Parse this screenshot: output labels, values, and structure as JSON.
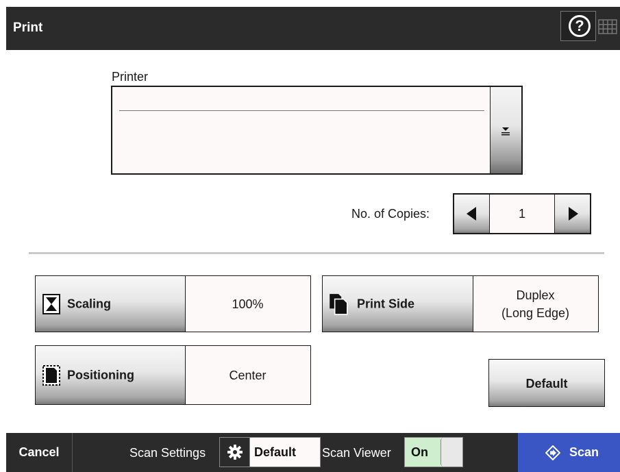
{
  "header": {
    "title": "Print",
    "help_icon": "help-circle-icon",
    "keyboard_icon": "keyboard-icon"
  },
  "printer": {
    "label": "Printer",
    "value": "",
    "dropdown_icon": "dropdown-arrow-icon"
  },
  "copies": {
    "label": "No. of Copies:",
    "value": "1"
  },
  "settings": {
    "scaling": {
      "label": "Scaling",
      "value": "100%",
      "icon": "scaling-page-icon"
    },
    "print_side": {
      "label": "Print Side",
      "value_line1": "Duplex",
      "value_line2": "(Long Edge)",
      "icon": "duplex-pages-icon"
    },
    "positioning": {
      "label": "Positioning",
      "value": "Center",
      "icon": "positioning-page-icon"
    },
    "default_label": "Default"
  },
  "bottombar": {
    "cancel": "Cancel",
    "scan_settings_label": "Scan Settings",
    "scan_settings_value": "Default",
    "scan_viewer_label": "Scan Viewer",
    "scan_viewer_value": "On",
    "scan": "Scan"
  },
  "colors": {
    "bar": "#2b2b2b",
    "scan_button": "#3a55c4",
    "toggle_on": "#cfeecd",
    "field_bg": "#fdf9f8"
  }
}
